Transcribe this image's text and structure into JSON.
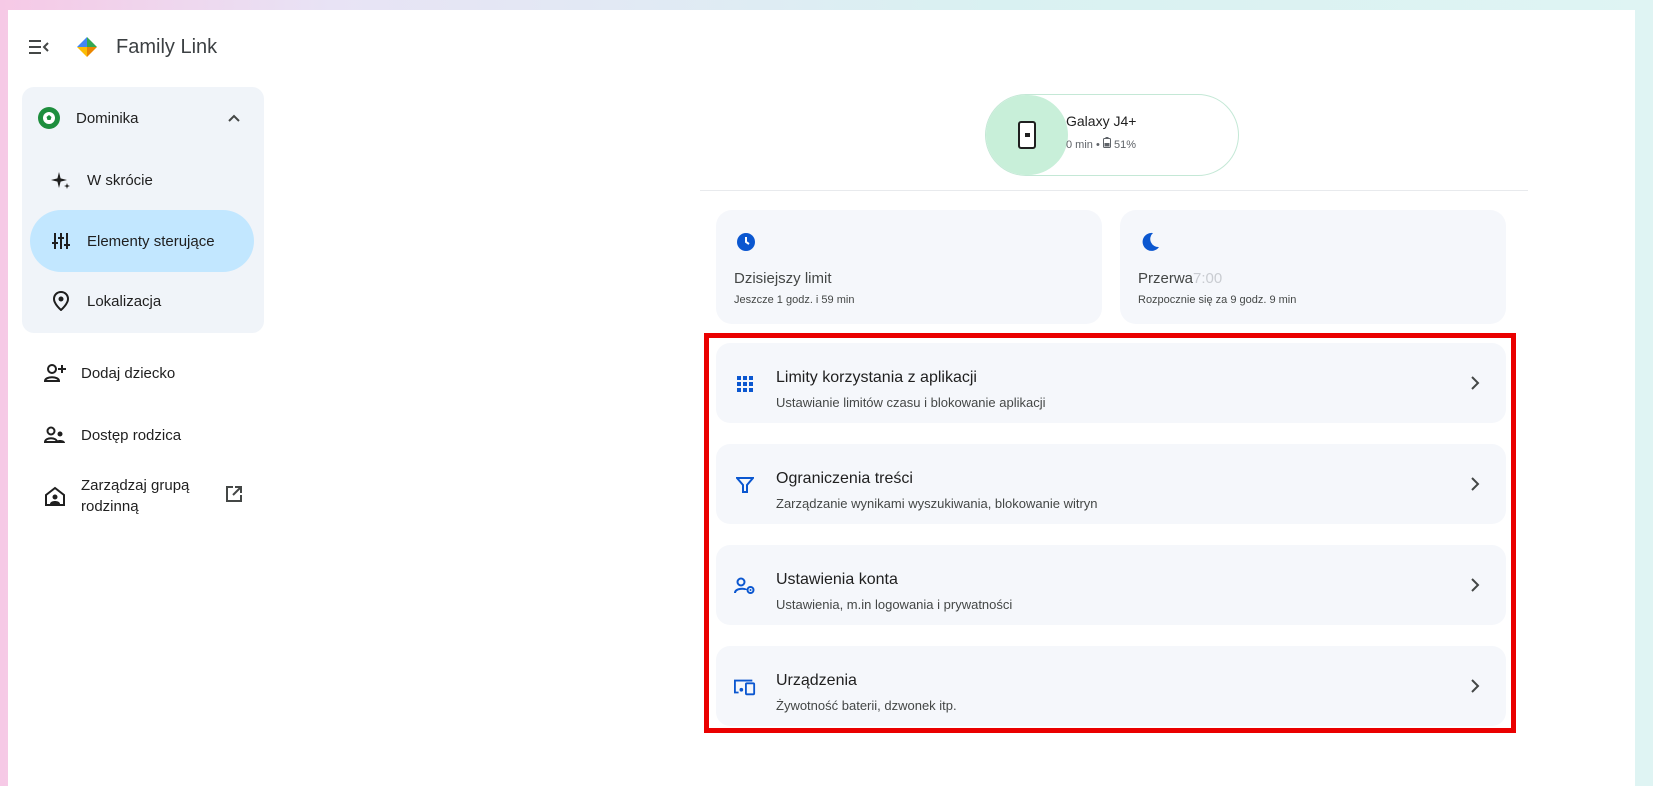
{
  "header": {
    "menu_icon": "menu-open-icon",
    "logo_icon": "family-link-logo",
    "title": "Family Link"
  },
  "sidebar": {
    "child": {
      "name": "Dominika",
      "avatar_icon": "soccer-ball-avatar",
      "expanded": true
    },
    "child_items": [
      {
        "label": "W skrócie",
        "icon": "sparkle-icon",
        "active": false
      },
      {
        "label": "Elementy sterujące",
        "icon": "tune-icon",
        "active": true
      },
      {
        "label": "Lokalizacja",
        "icon": "location-pin-icon",
        "active": false
      }
    ],
    "items": [
      {
        "label": "Dodaj dziecko",
        "icon": "add-person-icon"
      },
      {
        "label": "Dostęp rodzica",
        "icon": "supervisor-icon"
      },
      {
        "label_line1": "Zarządzaj grupą",
        "label_line2": "rodzinną",
        "icon": "family-home-icon",
        "trailing_icon": "open-in-new-icon"
      }
    ]
  },
  "device": {
    "name": "Galaxy J4+",
    "screen_time": "0 min",
    "separator": "•",
    "battery": "51%",
    "icon": "phone-icon"
  },
  "cards": [
    {
      "icon": "clock-icon",
      "title": "Dzisiejszy limit",
      "subtitle": "Jeszcze 1 godz. i 59 min"
    },
    {
      "icon": "moon-icon",
      "title": "Przerwa",
      "title_ghost": "7:00",
      "subtitle": "Rozpocznie się za 9 godz. 9 min"
    }
  ],
  "settings": [
    {
      "icon": "apps-grid-icon",
      "title": "Limity korzystania z aplikacji",
      "subtitle": "Ustawianie limitów czasu i blokowanie aplikacji"
    },
    {
      "icon": "filter-icon",
      "title": "Ograniczenia treści",
      "subtitle": "Zarządzanie wynikami wyszukiwania, blokowanie witryn"
    },
    {
      "icon": "manage-account-icon",
      "title": "Ustawienia konta",
      "subtitle": "Ustawienia, m.in logowania i prywatności"
    },
    {
      "icon": "devices-icon",
      "title": "Urządzenia",
      "subtitle": "Żywotność baterii, dzwonek itp."
    }
  ],
  "colors": {
    "accent": "#0b57d0",
    "active_nav": "#c2e7ff",
    "highlight": "#ea0000",
    "device_green": "#c8efd9"
  }
}
